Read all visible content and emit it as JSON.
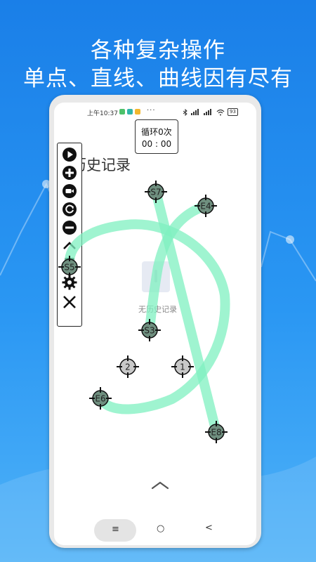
{
  "hero": {
    "line1": "各种复杂操作",
    "line2": "单点、直线、曲线因有尽有"
  },
  "status_bar": {
    "time": "上午10:37",
    "more": "···",
    "battery": "93"
  },
  "loop_counter": {
    "label": "循环0次",
    "timer": "00 : 00"
  },
  "page": {
    "title": "历史记录",
    "empty_text": "无历史记录"
  },
  "toolbar": {
    "items": [
      "play-icon",
      "plus-icon",
      "record-icon",
      "refresh-icon",
      "minus-icon",
      "collapse-chevron-icon",
      "save-icon",
      "settings-icon",
      "close-icon"
    ]
  },
  "touch_points": [
    {
      "label": "S7"
    },
    {
      "label": "E4"
    },
    {
      "label": "S5"
    },
    {
      "label": "S3"
    },
    {
      "label": "2"
    },
    {
      "label": "1"
    },
    {
      "label": "E6"
    },
    {
      "label": "E8"
    }
  ],
  "nav_bar": {
    "menu": "≡",
    "home": "○",
    "back": "<"
  },
  "colors": {
    "background": "#1a7fe8",
    "gesture_path": "#7ff0c0",
    "marker_fill_active": "#6f8f7f",
    "marker_fill_idle": "#c8c8c8"
  }
}
